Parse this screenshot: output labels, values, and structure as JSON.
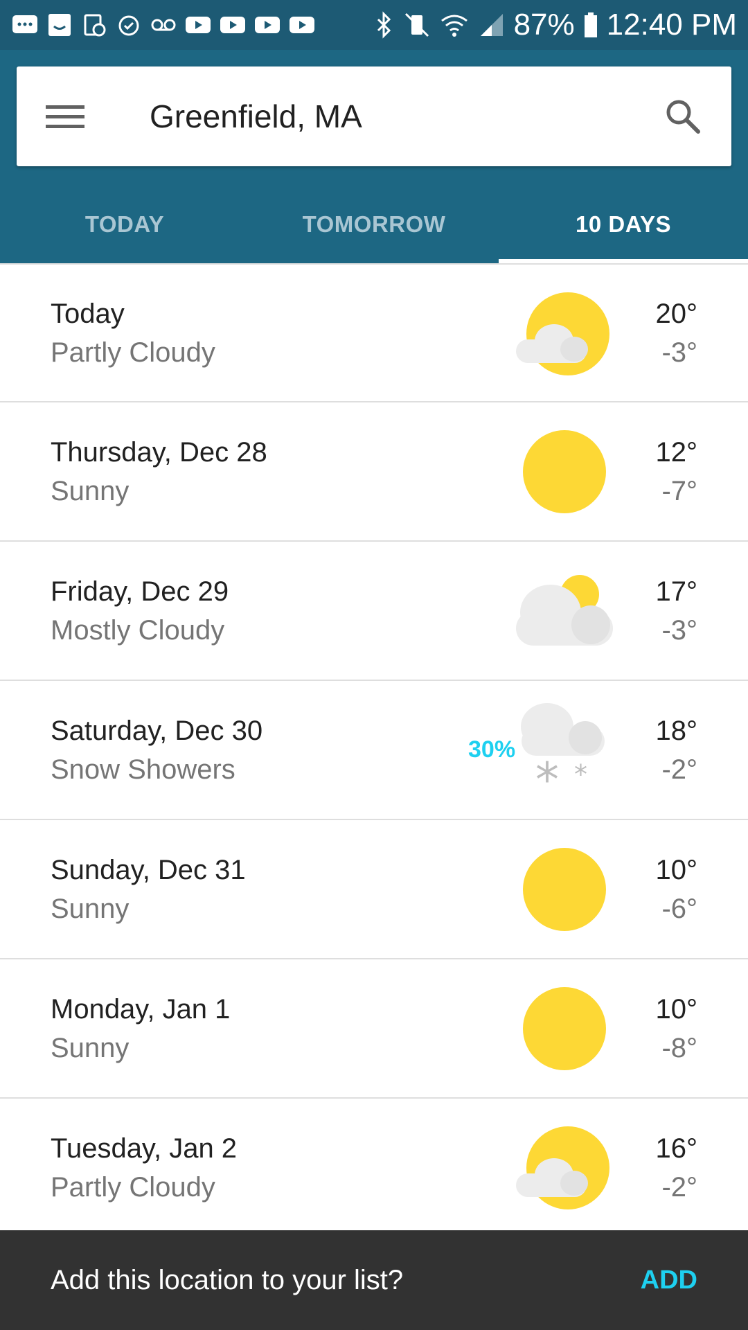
{
  "status_bar": {
    "battery": "87%",
    "time": "12:40 PM"
  },
  "search": {
    "location": "Greenfield, MA"
  },
  "tabs": [
    {
      "label": "TODAY",
      "active": false
    },
    {
      "label": "TOMORROW",
      "active": false
    },
    {
      "label": "10 DAYS",
      "active": true
    }
  ],
  "forecast": [
    {
      "day": "Today",
      "condition": "Partly Cloudy",
      "high": "20°",
      "low": "-3°",
      "icon": "partly-cloudy-icon",
      "precip": ""
    },
    {
      "day": "Thursday, Dec 28",
      "condition": "Sunny",
      "high": "12°",
      "low": "-7°",
      "icon": "sun-icon",
      "precip": ""
    },
    {
      "day": "Friday, Dec 29",
      "condition": "Mostly Cloudy",
      "high": "17°",
      "low": "-3°",
      "icon": "mostly-cloudy-icon",
      "precip": ""
    },
    {
      "day": "Saturday, Dec 30",
      "condition": "Snow Showers",
      "high": "18°",
      "low": "-2°",
      "icon": "snow-showers-icon",
      "precip": "30%"
    },
    {
      "day": "Sunday, Dec 31",
      "condition": "Sunny",
      "high": "10°",
      "low": "-6°",
      "icon": "sun-icon",
      "precip": ""
    },
    {
      "day": "Monday, Jan 1",
      "condition": "Sunny",
      "high": "10°",
      "low": "-8°",
      "icon": "sun-icon",
      "precip": ""
    },
    {
      "day": "Tuesday, Jan 2",
      "condition": "Partly Cloudy",
      "high": "16°",
      "low": "-2°",
      "icon": "partly-cloudy-icon",
      "precip": ""
    }
  ],
  "snackbar": {
    "message": "Add this location to your list?",
    "action": "ADD"
  },
  "colors": {
    "header": "#1d6783",
    "status_bar": "#1d5a74",
    "sun": "#fdd835",
    "cloud": "#e8e8e8",
    "accent": "#1ed0f0"
  }
}
